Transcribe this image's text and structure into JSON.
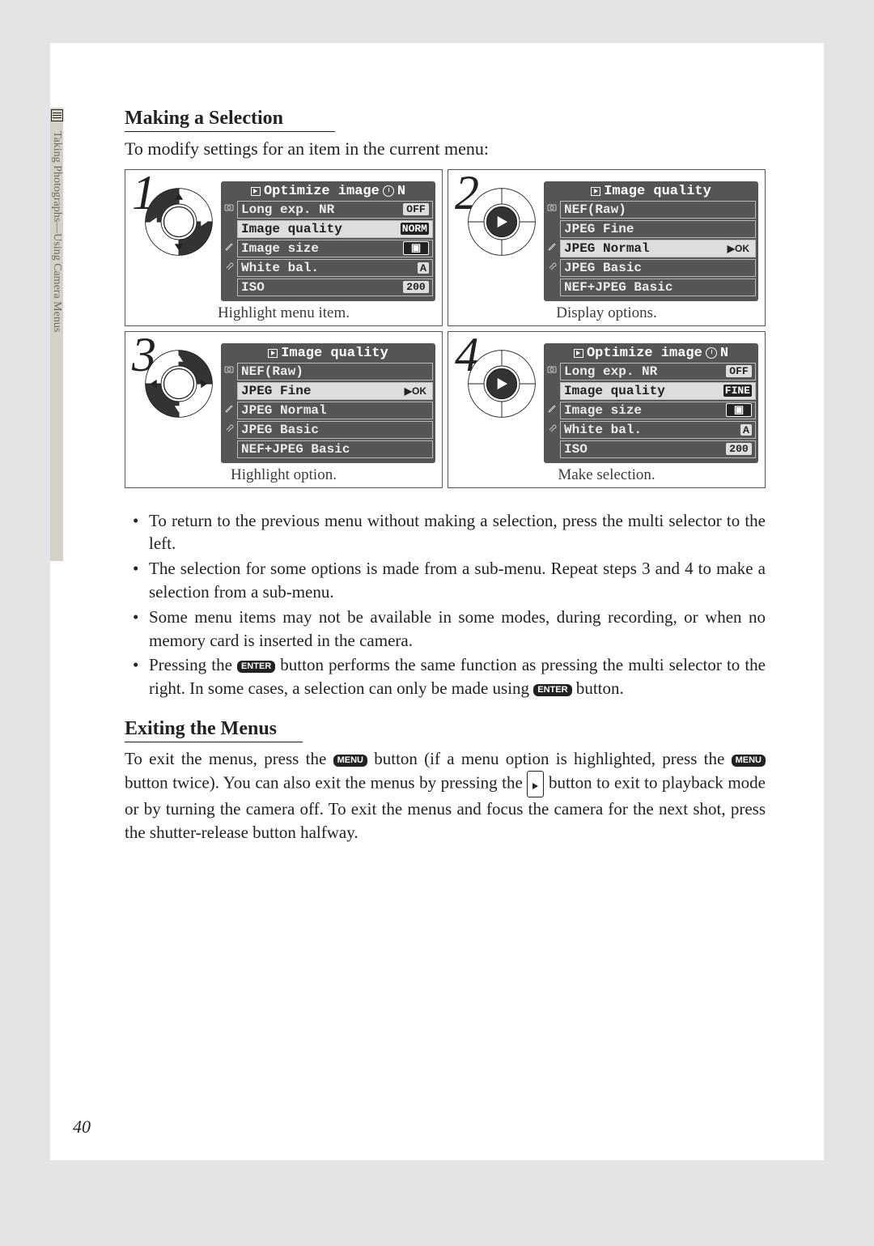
{
  "sidebar": {
    "label": "Taking Photographs—Using Camera Menus"
  },
  "section1": {
    "title": "Making a Selection",
    "intro": "To modify settings for an item in the current menu:"
  },
  "steps": [
    {
      "n": "1",
      "caption": "Highlight menu item.",
      "dpad": "horizontal",
      "lcd": {
        "title": "Optimize image",
        "title_icon": "play",
        "title_right_icon": "timer",
        "title_right": "N",
        "rows": [
          {
            "icon": "camera",
            "label": "Long exp. NR",
            "val": "OFF",
            "val_style": "light"
          },
          {
            "icon": "",
            "label": "Image quality",
            "val": "NORM",
            "val_style": "dark",
            "sel": true
          },
          {
            "icon": "pencil",
            "label": "Image size",
            "val": "",
            "val_style": "box"
          },
          {
            "icon": "wrench",
            "label": "White bal.",
            "val": "A",
            "val_style": "wb"
          },
          {
            "icon": "",
            "label": "ISO",
            "val": "200",
            "val_style": "light"
          }
        ]
      }
    },
    {
      "n": "2",
      "caption": "Display options.",
      "dpad": "right",
      "lcd": {
        "title": "Image quality",
        "title_icon": "play",
        "rows": [
          {
            "icon": "camera",
            "label": "NEF(Raw)"
          },
          {
            "icon": "",
            "label": "JPEG Fine"
          },
          {
            "icon": "pencil",
            "label": "JPEG Normal",
            "sel": true,
            "ok": true
          },
          {
            "icon": "wrench",
            "label": "JPEG Basic"
          },
          {
            "icon": "",
            "label": "NEF+JPEG Basic"
          }
        ]
      }
    },
    {
      "n": "3",
      "caption": "Highlight option.",
      "dpad": "vertical",
      "lcd": {
        "title": "Image quality",
        "title_icon": "play",
        "rows": [
          {
            "icon": "camera",
            "label": "NEF(Raw)"
          },
          {
            "icon": "",
            "label": "JPEG Fine",
            "sel": true,
            "ok": true
          },
          {
            "icon": "pencil",
            "label": "JPEG Normal"
          },
          {
            "icon": "wrench",
            "label": "JPEG Basic"
          },
          {
            "icon": "",
            "label": "NEF+JPEG Basic"
          }
        ]
      }
    },
    {
      "n": "4",
      "caption": "Make selection.",
      "dpad": "right",
      "lcd": {
        "title": "Optimize image",
        "title_icon": "play",
        "title_right_icon": "timer",
        "title_right": "N",
        "rows": [
          {
            "icon": "camera",
            "label": "Long exp. NR",
            "val": "OFF",
            "val_style": "light"
          },
          {
            "icon": "",
            "label": "Image quality",
            "val": "FINE",
            "val_style": "dark",
            "sel": true
          },
          {
            "icon": "pencil",
            "label": "Image size",
            "val": "",
            "val_style": "box"
          },
          {
            "icon": "wrench",
            "label": "White bal.",
            "val": "A",
            "val_style": "wb"
          },
          {
            "icon": "",
            "label": "ISO",
            "val": "200",
            "val_style": "light"
          }
        ]
      }
    }
  ],
  "bullets": [
    "To return to the previous menu without making a selection, press the multi selector to the left.",
    "The selection for some options is made from a sub-menu.  Repeat steps 3 and 4 to make a selection from a sub-menu.",
    "Some menu items may not be available in some modes, during recording, or when no memory card is inserted in the camera.",
    {
      "parts": [
        "Pressing the ",
        {
          "btn": "ENTER"
        },
        " button performs the same function as pressing the multi selector to the right.  In some cases, a selection can only be made using ",
        {
          "btn": "ENTER"
        },
        " button."
      ]
    }
  ],
  "section2": {
    "title": "Exiting the Menus",
    "body_parts": [
      "To exit the menus, press the ",
      {
        "btn": "MENU"
      },
      " button (if a menu option is highlighted, press the ",
      {
        "btn": "MENU"
      },
      " button twice).  You can also exit the menus by pressing the ",
      {
        "play": true
      },
      " button to exit to playback mode or by turning the camera off.  To exit the menus and focus the camera for the next shot, press the shutter-release button halfway."
    ]
  },
  "page_number": "40"
}
